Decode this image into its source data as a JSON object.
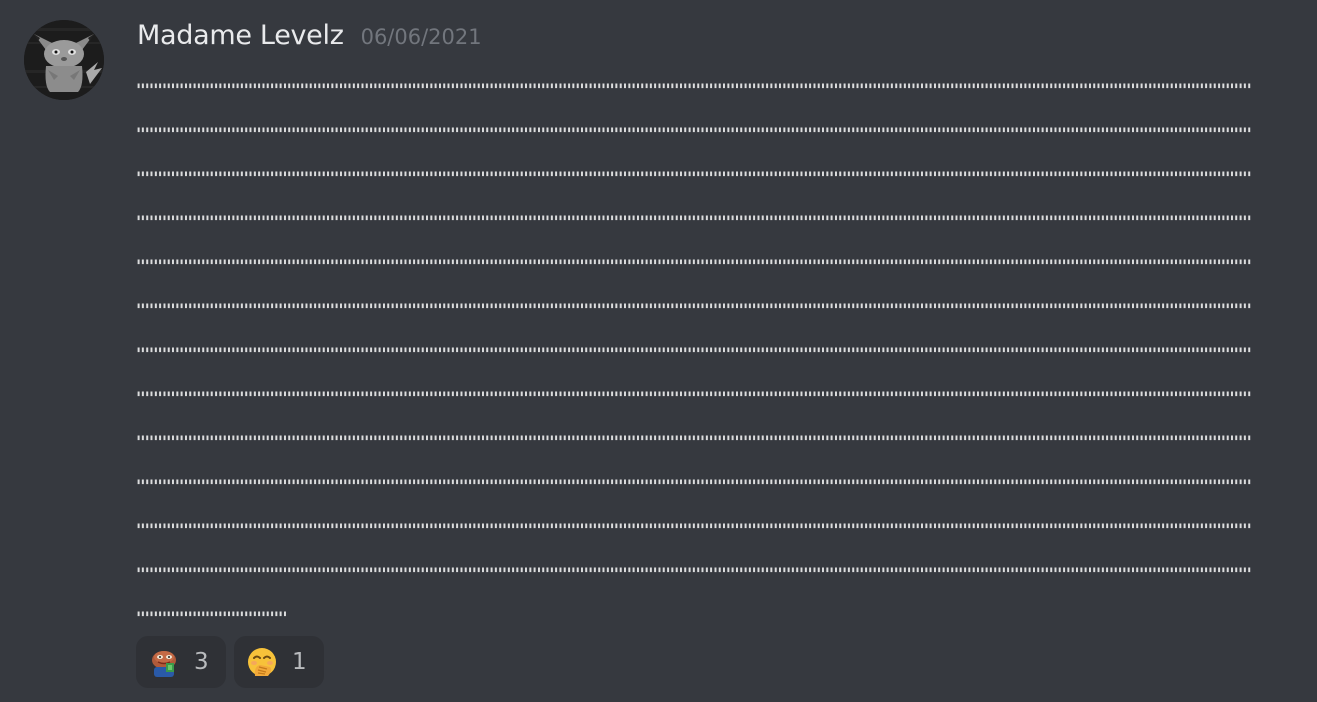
{
  "message": {
    "author": "Madame Levelz",
    "timestamp": "06/06/2021",
    "lines": [
      "'''''''''''''''''''''''''''''''''''''''''''''''''''''''''''''''''''''''''''''''''''''''''''''''''''''''''''''''''''''''''''''''''''''''''''''''''''''''''''''''''''''''''''''''''''''''''''''''''''''''''''''''''''''''''''''''''''''''''''''''''''''''''''''''''''",
      "'''''''''''''''''''''''''''''''''''''''''''''''''''''''''''''''''''''''''''''''''''''''''''''''''''''''''''''''''''''''''''''''''''''''''''''''''''''''''''''''''''''''''''''''''''''''''''''''''''''''''''''''''''''''''''''''''''''''''''''''''''''''''''''''''''",
      "'''''''''''''''''''''''''''''''''''''''''''''''''''''''''''''''''''''''''''''''''''''''''''''''''''''''''''''''''''''''''''''''''''''''''''''''''''''''''''''''''''''''''''''''''''''''''''''''''''''''''''''''''''''''''''''''''''''''''''''''''''''''''''''''''''",
      "'''''''''''''''''''''''''''''''''''''''''''''''''''''''''''''''''''''''''''''''''''''''''''''''''''''''''''''''''''''''''''''''''''''''''''''''''''''''''''''''''''''''''''''''''''''''''''''''''''''''''''''''''''''''''''''''''''''''''''''''''''''''''''''''''''",
      "'''''''''''''''''''''''''''''''''''''''''''''''''''''''''''''''''''''''''''''''''''''''''''''''''''''''''''''''''''''''''''''''''''''''''''''''''''''''''''''''''''''''''''''''''''''''''''''''''''''''''''''''''''''''''''''''''''''''''''''''''''''''''''''''''''",
      "'''''''''''''''''''''''''''''''''''''''''''''''''''''''''''''''''''''''''''''''''''''''''''''''''''''''''''''''''''''''''''''''''''''''''''''''''''''''''''''''''''''''''''''''''''''''''''''''''''''''''''''''''''''''''''''''''''''''''''''''''''''''''''''''''''",
      "'''''''''''''''''''''''''''''''''''''''''''''''''''''''''''''''''''''''''''''''''''''''''''''''''''''''''''''''''''''''''''''''''''''''''''''''''''''''''''''''''''''''''''''''''''''''''''''''''''''''''''''''''''''''''''''''''''''''''''''''''''''''''''''''''''",
      "'''''''''''''''''''''''''''''''''''''''''''''''''''''''''''''''''''''''''''''''''''''''''''''''''''''''''''''''''''''''''''''''''''''''''''''''''''''''''''''''''''''''''''''''''''''''''''''''''''''''''''''''''''''''''''''''''''''''''''''''''''''''''''''''''''",
      "'''''''''''''''''''''''''''''''''''''''''''''''''''''''''''''''''''''''''''''''''''''''''''''''''''''''''''''''''''''''''''''''''''''''''''''''''''''''''''''''''''''''''''''''''''''''''''''''''''''''''''''''''''''''''''''''''''''''''''''''''''''''''''''''''''",
      "'''''''''''''''''''''''''''''''''''''''''''''''''''''''''''''''''''''''''''''''''''''''''''''''''''''''''''''''''''''''''''''''''''''''''''''''''''''''''''''''''''''''''''''''''''''''''''''''''''''''''''''''''''''''''''''''''''''''''''''''''''''''''''''''''''",
      "'''''''''''''''''''''''''''''''''''''''''''''''''''''''''''''''''''''''''''''''''''''''''''''''''''''''''''''''''''''''''''''''''''''''''''''''''''''''''''''''''''''''''''''''''''''''''''''''''''''''''''''''''''''''''''''''''''''''''''''''''''''''''''''''''''",
      "'''''''''''''''''''''''''''''''''''''''''''''''''''''''''''''''''''''''''''''''''''''''''''''''''''''''''''''''''''''''''''''''''''''''''''''''''''''''''''''''''''''''''''''''''''''''''''''''''''''''''''''''''''''''''''''''''''''''''''''''''''''''''''''''''''",
      "'''''''''''''''''''''''''''''''''''"
    ]
  },
  "reactions": [
    {
      "emoji": "pepe-money-emoji",
      "count": "3"
    },
    {
      "emoji": "face-with-hand-over-mouth-emoji",
      "count": "1"
    }
  ],
  "colors": {
    "background": "#36393f",
    "username": "#e9eaec",
    "timestamp": "#72767d",
    "reaction_bg": "#2f3136",
    "reaction_count": "#b9bbbe"
  },
  "avatar": {
    "icon": "pikachu-avatar-icon"
  }
}
